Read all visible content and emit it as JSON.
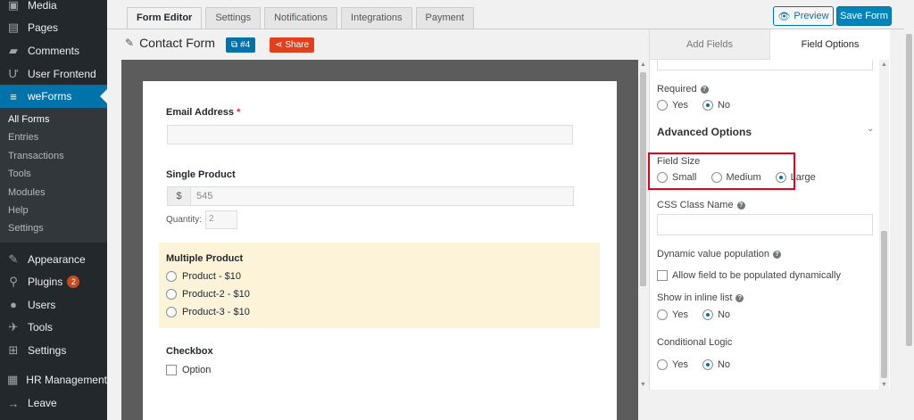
{
  "sidebar": {
    "top_items": [
      {
        "label": "Media",
        "icon": "media-icon"
      },
      {
        "label": "Pages",
        "icon": "pages-icon"
      },
      {
        "label": "Comments",
        "icon": "comments-icon"
      },
      {
        "label": "User Frontend",
        "icon": "user-frontend-icon"
      },
      {
        "label": "weForms",
        "icon": "weforms-icon"
      }
    ],
    "submenu": [
      "All Forms",
      "Entries",
      "Transactions",
      "Tools",
      "Modules",
      "Help",
      "Settings"
    ],
    "bottom_items": [
      {
        "label": "Appearance",
        "icon": "appearance-icon"
      },
      {
        "label": "Plugins",
        "icon": "plugins-icon",
        "badge": "2"
      },
      {
        "label": "Users",
        "icon": "users-icon"
      },
      {
        "label": "Tools",
        "icon": "tools-icon"
      },
      {
        "label": "Settings",
        "icon": "settings-icon"
      },
      {
        "label": "HR Management",
        "icon": "hr-icon"
      },
      {
        "label": "Leave",
        "icon": "leave-icon"
      }
    ]
  },
  "tabs": [
    "Form Editor",
    "Settings",
    "Notifications",
    "Integrations",
    "Payment"
  ],
  "toolbar": {
    "preview_label": "Preview",
    "save_label": "Save Form"
  },
  "form": {
    "title": "Contact Form",
    "id_label": "#4",
    "share_label": "Share"
  },
  "canvas": {
    "email_label": "Email Address",
    "required_mark": "*",
    "single_product_label": "Single Product",
    "currency": "$",
    "price_value": "545",
    "quantity_label": "Quantity:",
    "quantity_value": "2",
    "multiple_product_label": "Multiple Product",
    "products": [
      "Product - $10",
      "Product-2 - $10",
      "Product-3 - $10"
    ],
    "checkbox_label": "Checkbox",
    "checkbox_option": "Option"
  },
  "panel": {
    "tab_add": "Add Fields",
    "tab_options": "Field Options",
    "required_label": "Required",
    "yes": "Yes",
    "no": "No",
    "advanced_options": "Advanced Options",
    "field_size_label": "Field Size",
    "sizes": [
      "Small",
      "Medium",
      "Large"
    ],
    "css_class_label": "CSS Class Name",
    "dynamic_label": "Dynamic value population",
    "dynamic_checkbox": "Allow field to be populated dynamically",
    "inline_label": "Show in inline list",
    "conditional_label": "Conditional Logic"
  },
  "colors": {
    "accent": "#0073aa",
    "sidebar_bg": "#23282d",
    "highlight_border": "#e2001a",
    "share": "#e2401c"
  }
}
